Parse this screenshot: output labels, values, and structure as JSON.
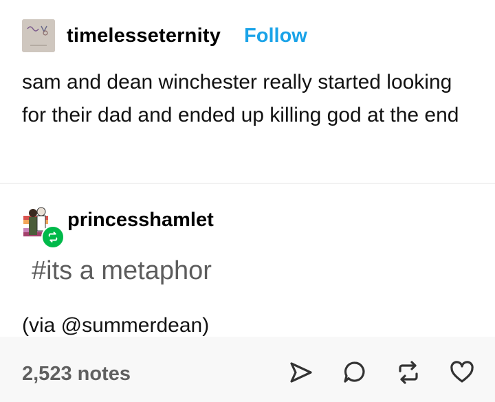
{
  "post": {
    "username": "timelesseternity",
    "follow_label": "Follow",
    "body": "sam and dean winchester really started looking for their dad and ended up killing god at the end"
  },
  "reblog": {
    "username": "princesshamlet",
    "tags": "#its a metaphor",
    "via": "(via @summerdean)"
  },
  "footer": {
    "notes": "2,523 notes",
    "icons": [
      "share-icon",
      "reply-icon",
      "reblog-icon",
      "like-icon"
    ]
  },
  "colors": {
    "follow": "#1aa3e8",
    "reblog_badge": "#00b94a",
    "footer_bg": "#f8f8f8"
  }
}
